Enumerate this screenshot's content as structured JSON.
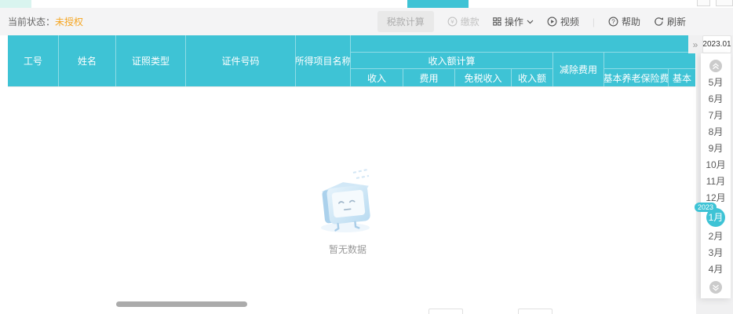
{
  "colors": {
    "accent_teal": "#3ec3d5",
    "status_orange": "#f5a623"
  },
  "status_bar": {
    "label": "当前状态：",
    "value": "未授权"
  },
  "toolbar": {
    "tax_calc": "税款计算",
    "pay": "缴款",
    "operate": "操作",
    "video": "视频",
    "help": "帮助",
    "refresh": "刷新",
    "divider": "|"
  },
  "table": {
    "fixed_columns": [
      "工号",
      "姓名",
      "证照类型",
      "证件号码",
      "所得项目名称"
    ],
    "income_group": "收入额计算",
    "deduction_column": "减除费用",
    "income_subcolumns": [
      "收入",
      "费用",
      "免税收入",
      "收入额"
    ],
    "insurance_subcolumns": [
      "基本养老保险费",
      "基本"
    ]
  },
  "empty_state": {
    "text": "暂无数据"
  },
  "month_panel": {
    "collapse_icon": "»",
    "period": "2023.01",
    "year_badge": "2023",
    "months": [
      "5月",
      "6月",
      "7月",
      "8月",
      "9月",
      "10月",
      "11月",
      "12月",
      "1月",
      "2月",
      "3月",
      "4月"
    ],
    "selected_month": "1月",
    "selected_index": 8
  }
}
